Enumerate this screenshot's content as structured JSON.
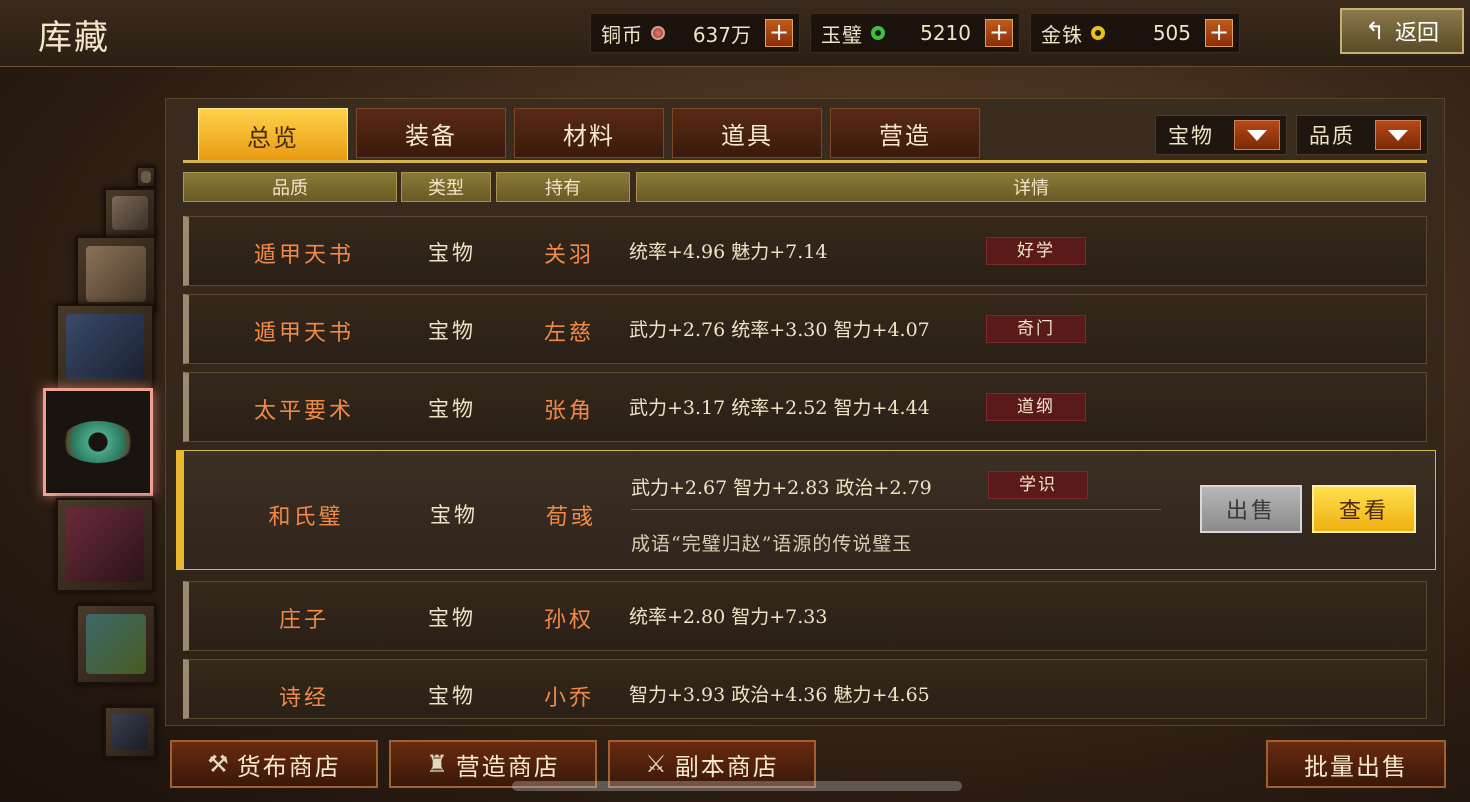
{
  "header": {
    "title": "库藏",
    "back_label": "返回",
    "resources": [
      {
        "label": "铜币",
        "value": "637万",
        "color": "#c0503a"
      },
      {
        "label": "玉璧",
        "value": "5210",
        "color": "#40c040"
      },
      {
        "label": "金铢",
        "value": "505",
        "color": "#e8c020"
      }
    ]
  },
  "tabs": [
    {
      "label": "总览",
      "active": true
    },
    {
      "label": "装备",
      "active": false
    },
    {
      "label": "材料",
      "active": false
    },
    {
      "label": "道具",
      "active": false
    },
    {
      "label": "营造",
      "active": false
    }
  ],
  "filters": {
    "type": "宝物",
    "quality": "品质"
  },
  "columns": {
    "quality": "品质",
    "type": "类型",
    "owner": "持有",
    "detail": "详情"
  },
  "rows": [
    {
      "name": "遁甲天书",
      "type": "宝物",
      "owner": "关羽",
      "stats": "统率+4.96 魅力+7.14",
      "tag": "好学"
    },
    {
      "name": "遁甲天书",
      "type": "宝物",
      "owner": "左慈",
      "stats": "武力+2.76 统率+3.30 智力+4.07",
      "tag": "奇门"
    },
    {
      "name": "太平要术",
      "type": "宝物",
      "owner": "张角",
      "stats": "武力+3.17 统率+2.52 智力+4.44",
      "tag": "道纲"
    },
    {
      "name": "和氏璧",
      "type": "宝物",
      "owner": "荀彧",
      "stats": "武力+2.67 智力+2.83 政治+2.79",
      "tag": "学识",
      "desc": "成语“完璧归赵”语源的传说璧玉"
    },
    {
      "name": "庄子",
      "type": "宝物",
      "owner": "孙权",
      "stats": "统率+2.80 智力+7.33",
      "tag": ""
    },
    {
      "name": "诗经",
      "type": "宝物",
      "owner": "小乔",
      "stats": "智力+3.93 政治+4.36 魅力+4.65",
      "tag": ""
    }
  ],
  "actions": {
    "sell": "出售",
    "view": "查看"
  },
  "bottom": {
    "currency_shop": "货布商店",
    "build_shop": "营造商店",
    "dungeon_shop": "副本商店",
    "bulk_sell": "批量出售"
  }
}
